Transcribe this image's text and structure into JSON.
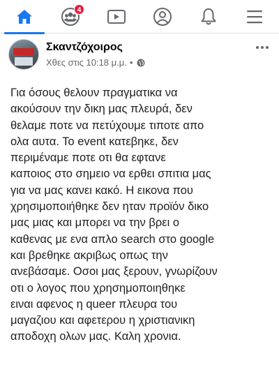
{
  "nav": {
    "tabs": [
      {
        "name": "home",
        "icon": "home-icon",
        "active": true
      },
      {
        "name": "groups",
        "icon": "groups-icon",
        "badge": "4"
      },
      {
        "name": "watch",
        "icon": "video-icon"
      },
      {
        "name": "profile",
        "icon": "profile-icon"
      },
      {
        "name": "notifications",
        "icon": "bell-icon"
      },
      {
        "name": "menu",
        "icon": "hamburger-menu-icon"
      }
    ],
    "accent_color": "#1877f2",
    "badge_color": "#e41e3f"
  },
  "post": {
    "author": "Σκαντζόχοιρος",
    "timestamp": "Χθες στις 10:18 μ.μ.",
    "separator": "•",
    "privacy_icon": "globe-icon",
    "more_icon": "more-options-icon",
    "text": "Για όσους θελουν πραγματικα να\nακούσουν την δικη μας πλευρά, δεν\nθελαμε ποτε να πετύχουμε τιποτε απο\nολα αυτα. Το event κατεβηκε, δεν\nπεριμέναμε ποτε οτι θα εφτανε\nκαποιος στο σημειο να ερθει σπιτια μας\nγια να μας κανει κακό. Η εικονα που\nχρησιμοποιήθηκε δεν ηταν προϊόν δικο\nμας μιας και μπορει να την βρει ο\nκαθενας με ενα απλο search στο google\nκαι βρεθηκε ακριβως οπως την\nανεβάσαμε. Οσοι μας ξερουν, γνωρίζουν\nοτι ο  λογος που χρησημοποιηθηκε\nειναι αφενος η queer πλευρα του\nμαγαζιου και αφετερου η χριστιανικη\nαποδοχη ολων μας. Καλη  χρονια."
  }
}
